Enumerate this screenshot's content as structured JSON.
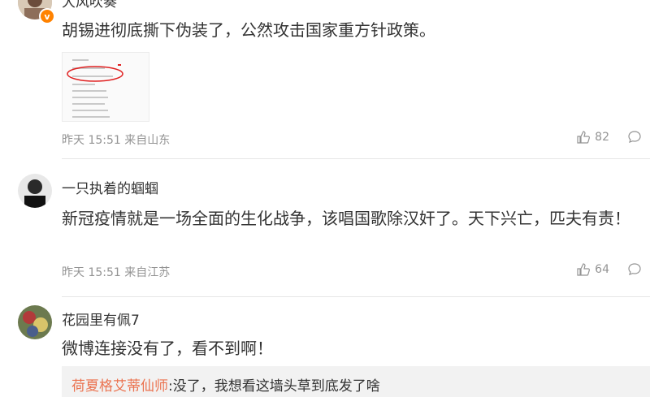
{
  "comments": [
    {
      "username": "大风吹奏",
      "content": "胡锡进彻底撕下伪装了，公然攻击国家重方针政策。",
      "meta": "昨天 15:51 来自山东",
      "likes": "82",
      "verified": "v"
    },
    {
      "username": "一只执着的蝈蝈",
      "content": "新冠疫情就是一场全面的生化战争，该唱国歌除汉奸了。天下兴亡，匹夫有责！",
      "meta": "昨天 15:51 来自江苏",
      "likes": "64"
    },
    {
      "username": "花园里有佩7",
      "content": "微博连接没有了，看不到啊！",
      "reply_user": "荷夏格艾蒂仙师",
      "reply_text": ":没了，我想看这墙头草到底发了啥"
    }
  ],
  "colors": {
    "meta": "#939393",
    "reply_user": "#eb7350",
    "verified": "#ff8200",
    "annotation_circle": "#e02020"
  },
  "icons": [
    "like-icon",
    "comment-icon",
    "verified-icon"
  ]
}
